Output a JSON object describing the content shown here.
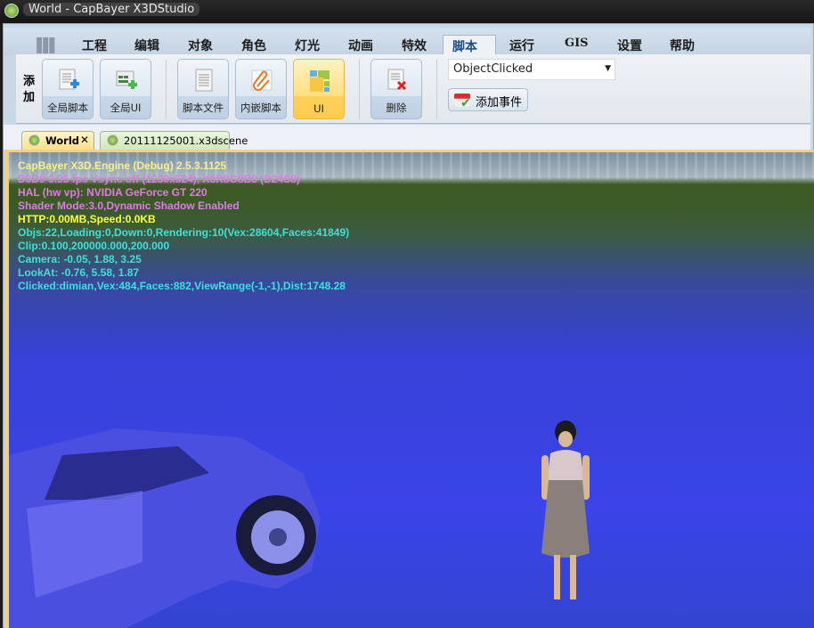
{
  "window": {
    "title": "World - CapBayer X3DStudio"
  },
  "menu_tabs": [
    {
      "label": "工程"
    },
    {
      "label": "编辑"
    },
    {
      "label": "对象"
    },
    {
      "label": "角色"
    },
    {
      "label": "灯光"
    },
    {
      "label": "动画"
    },
    {
      "label": "特效"
    },
    {
      "label": "脚本",
      "active": true
    },
    {
      "label": "运行"
    },
    {
      "label": "GIS"
    },
    {
      "label": "设置"
    },
    {
      "label": "帮助"
    }
  ],
  "ribbon": {
    "group_label": "添加",
    "buttons": [
      {
        "label": "全局脚本",
        "icon": "doc-add-icon"
      },
      {
        "label": "全局UI",
        "icon": "ui-add-icon"
      },
      {
        "label": "脚本文件",
        "icon": "script-file-icon"
      },
      {
        "label": "内嵌脚本",
        "icon": "paperclip-icon"
      },
      {
        "label": "UI",
        "icon": "ui-layout-icon",
        "selected": true
      },
      {
        "label": "删除",
        "icon": "delete-icon"
      }
    ],
    "event_combo": {
      "value": "ObjectClicked"
    },
    "add_event_label": "添加事件"
  },
  "doc_tabs": [
    {
      "label": "World",
      "active": true
    },
    {
      "label": "20111125001.x3dscene"
    }
  ],
  "osd": {
    "lines": [
      {
        "text": "CapBayer X3D.Engine (Debug) 2.5.3.1125",
        "color": "#f4f08c"
      },
      {
        "text": "D3D9 6.95 fps Vsync off (1230x524), X8R8G8B8 (D24S8)",
        "color": "#e07ae8"
      },
      {
        "text": "HAL (hw vp): NVIDIA GeForce GT 220",
        "color": "#e07ae8"
      },
      {
        "text": "Shader Mode:3.0,Dynamic Shadow Enabled",
        "color": "#e07ae8"
      },
      {
        "text": "HTTP:0.00MB,Speed:0.0KB",
        "color": "#ffff33"
      },
      {
        "text": "Objs:22,Loading:0,Down:0,Rendering:10(Vex:28604,Faces:41849)",
        "color": "#3fe0d8"
      },
      {
        "text": "Clip:0.100,200000.000,200.000",
        "color": "#3fe0d8"
      },
      {
        "text": "Camera: -0.05, 1.88, 3.25",
        "color": "#3fe0d8"
      },
      {
        "text": "LookAt: -0.76, 5.58, 1.87",
        "color": "#3fe0d8"
      },
      {
        "text": "Clicked:dimian,Vex:484,Faces:882,ViewRange(-1,-1),Dist:1748.28",
        "color": "#3fe0d8"
      }
    ]
  }
}
